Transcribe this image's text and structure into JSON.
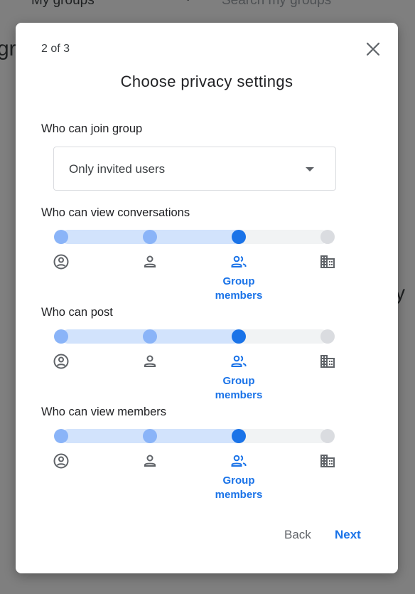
{
  "background": {
    "my_groups": "My groups",
    "search_placeholder": "Search my groups",
    "left_fragment": "gr",
    "right_fragment": "y"
  },
  "dialog": {
    "step": "2 of 3",
    "title": "Choose privacy settings",
    "join": {
      "label": "Who can join group",
      "selected": "Only invited users"
    },
    "sliders": [
      {
        "label": "Who can view conversations",
        "selected_index": 2,
        "selected_label": "Group members",
        "options": [
          "managers-icon",
          "person-icon",
          "group-members-icon",
          "organization-icon"
        ]
      },
      {
        "label": "Who can post",
        "selected_index": 2,
        "selected_label": "Group members",
        "options": [
          "managers-icon",
          "person-icon",
          "group-members-icon",
          "organization-icon"
        ]
      },
      {
        "label": "Who can view members",
        "selected_index": 2,
        "selected_label": "Group members",
        "options": [
          "managers-icon",
          "person-icon",
          "group-members-icon",
          "organization-icon"
        ]
      }
    ],
    "back_label": "Back",
    "next_label": "Next"
  },
  "colors": {
    "accent": "#1a73e8",
    "accent_light": "#8ab4f8",
    "track_fill": "#d2e3fc",
    "track": "#f1f3f4",
    "inactive": "#dadce0",
    "icon": "#5f6368"
  }
}
